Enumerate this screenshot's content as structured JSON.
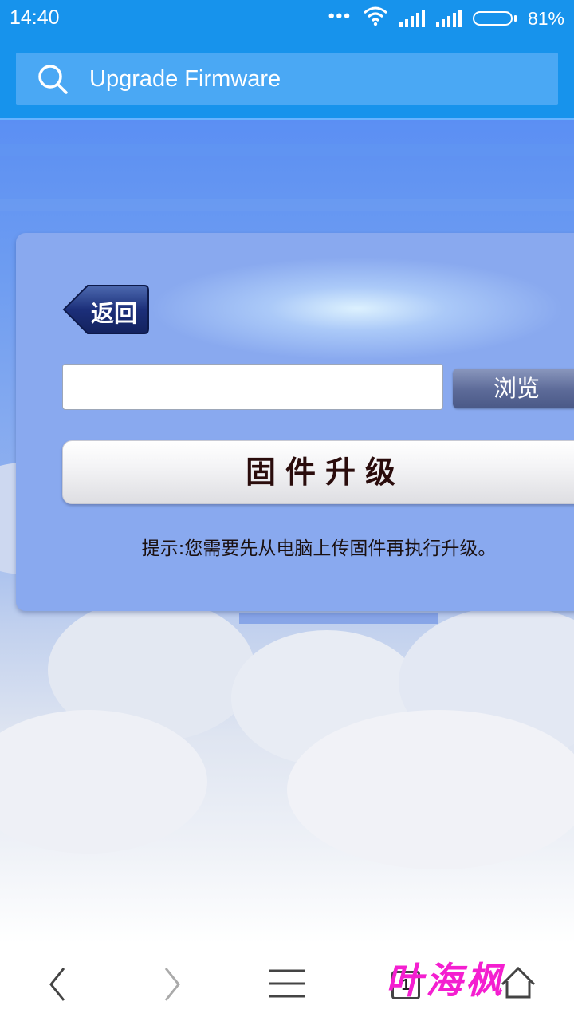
{
  "status_bar": {
    "time": "14:40",
    "battery_percent": "81%",
    "battery_level": 0.81
  },
  "browser": {
    "search_text": "Upgrade Firmware"
  },
  "page": {
    "back_label": "返回",
    "file_input_value": "",
    "browse_label": "浏览",
    "upgrade_label": "固件升级",
    "hint_text": "提示:您需要先从电脑上传固件再执行升级。"
  },
  "nav": {
    "tab_count": "1",
    "icons": [
      "back-arrow-icon",
      "forward-arrow-icon",
      "menu-icon",
      "tabs-icon",
      "home-icon"
    ]
  },
  "watermark": "叶海枫",
  "colors": {
    "status_bar": "#1793ec",
    "search_box": "#4aa8f4",
    "panel": "#89a9ef",
    "watermark": "#f41fd0"
  }
}
